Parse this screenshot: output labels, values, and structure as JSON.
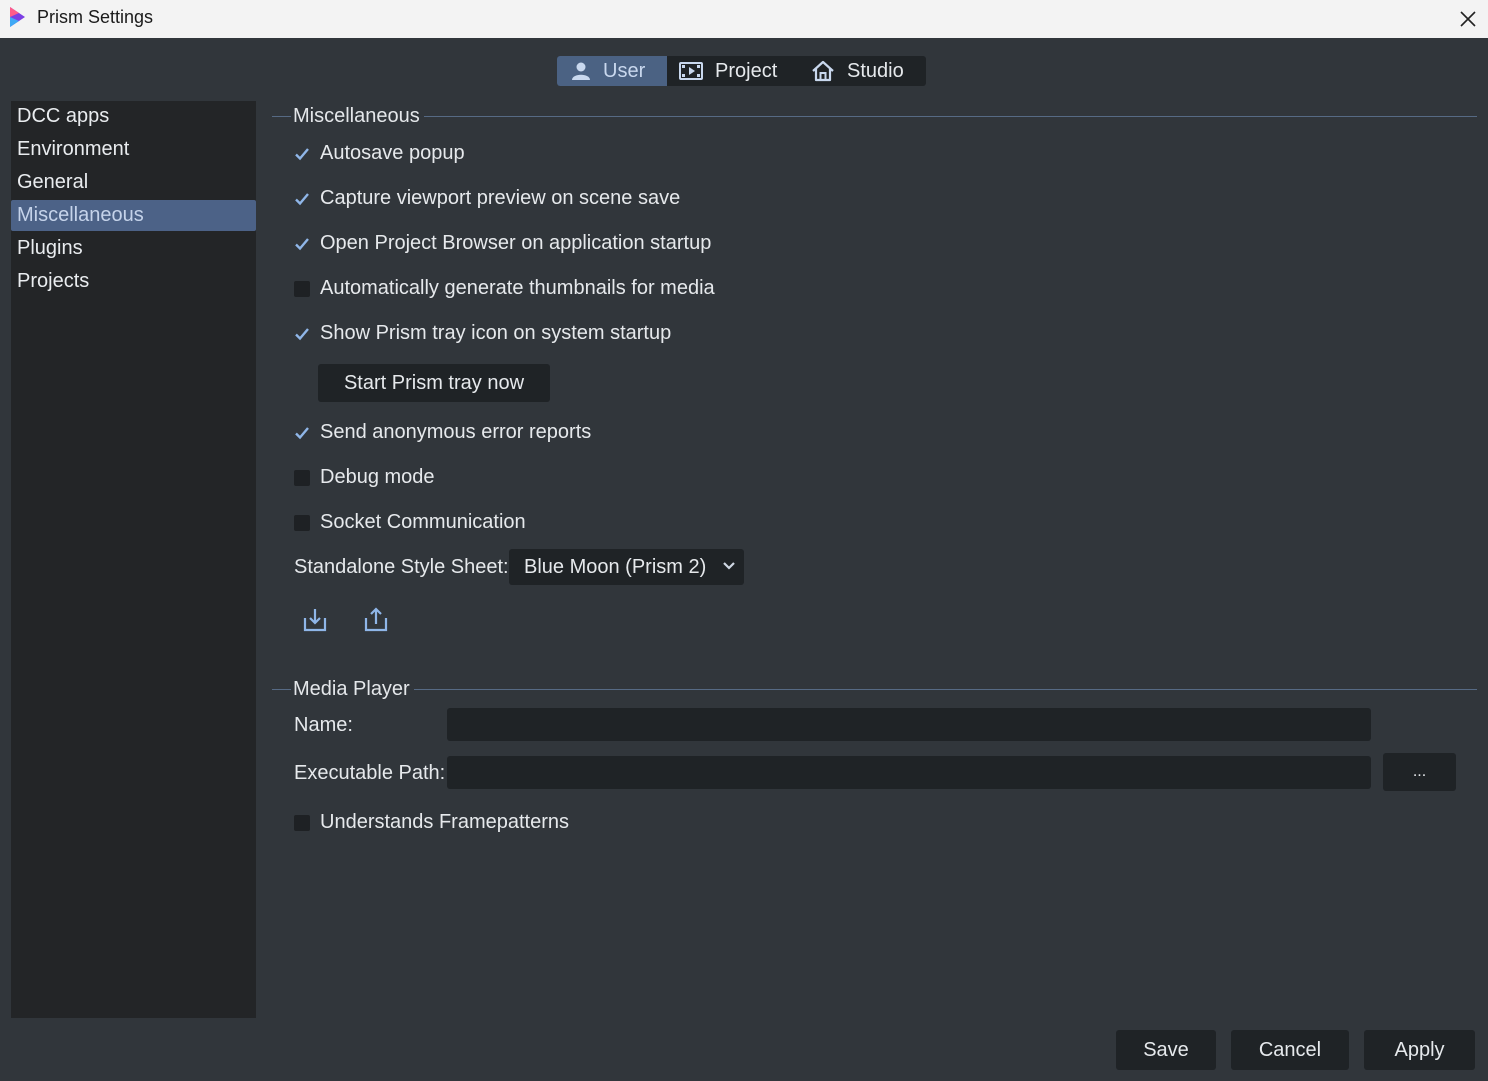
{
  "window": {
    "title": "Prism Settings"
  },
  "tabs": [
    {
      "label": "User",
      "icon": "user-icon",
      "active": true
    },
    {
      "label": "Project",
      "icon": "film-icon",
      "active": false
    },
    {
      "label": "Studio",
      "icon": "home-icon",
      "active": false
    }
  ],
  "sidebar": {
    "items": [
      {
        "label": "DCC apps"
      },
      {
        "label": "Environment"
      },
      {
        "label": "General"
      },
      {
        "label": "Miscellaneous",
        "selected": true
      },
      {
        "label": "Plugins"
      },
      {
        "label": "Projects"
      }
    ]
  },
  "misc": {
    "title": "Miscellaneous",
    "options": [
      {
        "label": "Autosave popup",
        "checked": true
      },
      {
        "label": "Capture viewport preview on scene save",
        "checked": true
      },
      {
        "label": "Open Project Browser on application startup",
        "checked": true
      },
      {
        "label": "Automatically generate thumbnails for media",
        "checked": false
      },
      {
        "label": "Show Prism tray icon on system startup",
        "checked": true
      },
      {
        "label": "Send anonymous error reports",
        "checked": true
      },
      {
        "label": "Debug mode",
        "checked": false
      },
      {
        "label": "Socket Communication",
        "checked": false
      }
    ],
    "start_tray_label": "Start Prism tray now",
    "stylesheet_label": "Standalone Style Sheet:",
    "stylesheet_value": "Blue Moon (Prism 2)",
    "import_icon": "import-icon",
    "export_icon": "export-icon"
  },
  "media_player": {
    "title": "Media Player",
    "name_label": "Name:",
    "name_value": "",
    "path_label": "Executable Path:",
    "path_value": "",
    "browse_label": "...",
    "framepatterns_label": "Understands Framepatterns",
    "framepatterns_checked": false
  },
  "footer": {
    "save": "Save",
    "cancel": "Cancel",
    "apply": "Apply"
  },
  "colors": {
    "accent": "#4c6287",
    "accent_text": "#c5d3ea",
    "background": "#31363b",
    "panel": "#232527",
    "line": "#566a84"
  }
}
